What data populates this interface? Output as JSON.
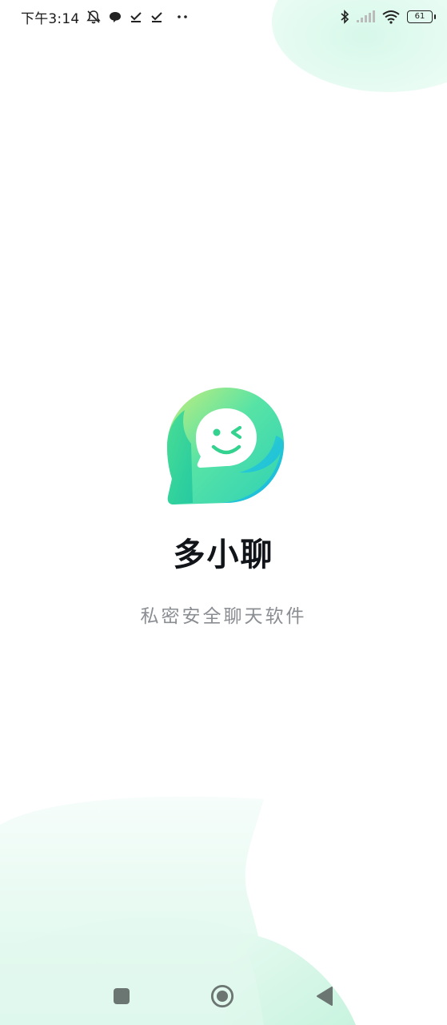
{
  "status_bar": {
    "time": "下午3:14",
    "battery_level": "61",
    "icons": [
      "mute-bell-icon",
      "chat-bubble-icon",
      "check-icon",
      "check-icon",
      "more-dots-icon",
      "bluetooth-icon",
      "signal-icon",
      "wifi-icon",
      "battery-icon"
    ]
  },
  "app": {
    "name": "多小聊",
    "tagline": "私密安全聊天软件",
    "logo_icon": "chat-bubble-smile-logo",
    "colors": {
      "green": "#3ddc97",
      "teal": "#1fc8c8",
      "lime": "#b6ec7a",
      "blue": "#17b8e6"
    }
  },
  "nav_bar": {
    "buttons": [
      "recents-button",
      "home-button",
      "back-button"
    ]
  }
}
